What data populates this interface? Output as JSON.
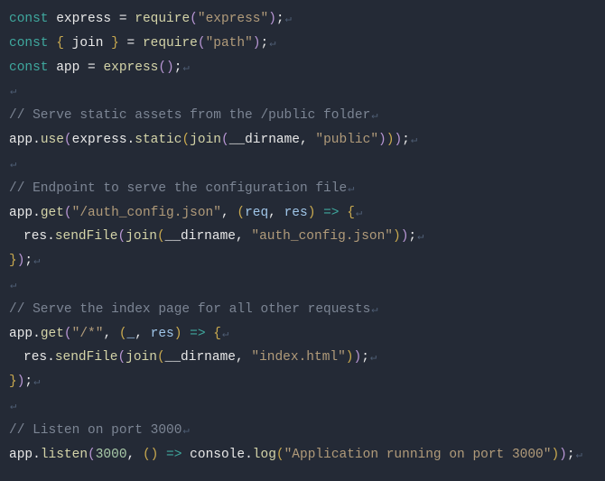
{
  "code": {
    "lines": [
      {
        "tokens": [
          {
            "t": "const ",
            "c": "tok-keyword"
          },
          {
            "t": "express ",
            "c": "tok-default"
          },
          {
            "t": "= ",
            "c": "tok-default"
          },
          {
            "t": "require",
            "c": "tok-method"
          },
          {
            "t": "(",
            "c": "tok-paren"
          },
          {
            "t": "\"express\"",
            "c": "tok-string"
          },
          {
            "t": ")",
            "c": "tok-paren"
          },
          {
            "t": ";",
            "c": "tok-default"
          }
        ],
        "eol": true,
        "indent": 0
      },
      {
        "tokens": [
          {
            "t": "const ",
            "c": "tok-keyword"
          },
          {
            "t": "{ ",
            "c": "tok-brace"
          },
          {
            "t": "join ",
            "c": "tok-default"
          },
          {
            "t": "} ",
            "c": "tok-brace"
          },
          {
            "t": "= ",
            "c": "tok-default"
          },
          {
            "t": "require",
            "c": "tok-method"
          },
          {
            "t": "(",
            "c": "tok-paren"
          },
          {
            "t": "\"path\"",
            "c": "tok-string"
          },
          {
            "t": ")",
            "c": "tok-paren"
          },
          {
            "t": ";",
            "c": "tok-default"
          }
        ],
        "eol": true,
        "indent": 0
      },
      {
        "tokens": [
          {
            "t": "const ",
            "c": "tok-keyword"
          },
          {
            "t": "app ",
            "c": "tok-default"
          },
          {
            "t": "= ",
            "c": "tok-default"
          },
          {
            "t": "express",
            "c": "tok-method"
          },
          {
            "t": "()",
            "c": "tok-paren"
          },
          {
            "t": ";",
            "c": "tok-default"
          }
        ],
        "eol": true,
        "indent": 0
      },
      {
        "tokens": [],
        "eol": true,
        "indent": 0
      },
      {
        "tokens": [
          {
            "t": "// Serve static assets from the /public folder",
            "c": "tok-comment"
          }
        ],
        "eol": true,
        "indent": 0
      },
      {
        "tokens": [
          {
            "t": "app.",
            "c": "tok-default"
          },
          {
            "t": "use",
            "c": "tok-method"
          },
          {
            "t": "(",
            "c": "tok-paren"
          },
          {
            "t": "express.",
            "c": "tok-default"
          },
          {
            "t": "static",
            "c": "tok-method"
          },
          {
            "t": "(",
            "c": "tok-brace"
          },
          {
            "t": "join",
            "c": "tok-method"
          },
          {
            "t": "(",
            "c": "tok-paren"
          },
          {
            "t": "__dirname, ",
            "c": "tok-default"
          },
          {
            "t": "\"public\"",
            "c": "tok-string"
          },
          {
            "t": ")",
            "c": "tok-paren"
          },
          {
            "t": ")",
            "c": "tok-brace"
          },
          {
            "t": ")",
            "c": "tok-paren"
          },
          {
            "t": ";",
            "c": "tok-default"
          }
        ],
        "eol": true,
        "indent": 0
      },
      {
        "tokens": [],
        "eol": true,
        "indent": 0
      },
      {
        "tokens": [
          {
            "t": "// Endpoint to serve the configuration file",
            "c": "tok-comment"
          }
        ],
        "eol": true,
        "indent": 0
      },
      {
        "tokens": [
          {
            "t": "app.",
            "c": "tok-default"
          },
          {
            "t": "get",
            "c": "tok-method"
          },
          {
            "t": "(",
            "c": "tok-paren"
          },
          {
            "t": "\"/auth_config.json\"",
            "c": "tok-string"
          },
          {
            "t": ", ",
            "c": "tok-default"
          },
          {
            "t": "(",
            "c": "tok-brace"
          },
          {
            "t": "req",
            "c": "tok-ident"
          },
          {
            "t": ", ",
            "c": "tok-default"
          },
          {
            "t": "res",
            "c": "tok-ident"
          },
          {
            "t": ")",
            "c": "tok-brace"
          },
          {
            "t": " => ",
            "c": "tok-keyword"
          },
          {
            "t": "{",
            "c": "tok-brace"
          }
        ],
        "eol": true,
        "indent": 0
      },
      {
        "tokens": [
          {
            "t": "res.",
            "c": "tok-default"
          },
          {
            "t": "sendFile",
            "c": "tok-method"
          },
          {
            "t": "(",
            "c": "tok-paren"
          },
          {
            "t": "join",
            "c": "tok-method"
          },
          {
            "t": "(",
            "c": "tok-brace"
          },
          {
            "t": "__dirname, ",
            "c": "tok-default"
          },
          {
            "t": "\"auth_config.json\"",
            "c": "tok-string"
          },
          {
            "t": ")",
            "c": "tok-brace"
          },
          {
            "t": ")",
            "c": "tok-paren"
          },
          {
            "t": ";",
            "c": "tok-default"
          }
        ],
        "eol": true,
        "indent": 1
      },
      {
        "tokens": [
          {
            "t": "}",
            "c": "tok-brace"
          },
          {
            "t": ")",
            "c": "tok-paren"
          },
          {
            "t": ";",
            "c": "tok-default"
          }
        ],
        "eol": true,
        "indent": 0
      },
      {
        "tokens": [],
        "eol": true,
        "indent": 0
      },
      {
        "tokens": [
          {
            "t": "// Serve the index page for all other requests",
            "c": "tok-comment"
          }
        ],
        "eol": true,
        "indent": 0
      },
      {
        "tokens": [
          {
            "t": "app.",
            "c": "tok-default"
          },
          {
            "t": "get",
            "c": "tok-method"
          },
          {
            "t": "(",
            "c": "tok-paren"
          },
          {
            "t": "\"/*\"",
            "c": "tok-string"
          },
          {
            "t": ", ",
            "c": "tok-default"
          },
          {
            "t": "(",
            "c": "tok-brace"
          },
          {
            "t": "_",
            "c": "tok-ident"
          },
          {
            "t": ", ",
            "c": "tok-default"
          },
          {
            "t": "res",
            "c": "tok-ident"
          },
          {
            "t": ")",
            "c": "tok-brace"
          },
          {
            "t": " => ",
            "c": "tok-keyword"
          },
          {
            "t": "{",
            "c": "tok-brace"
          }
        ],
        "eol": true,
        "indent": 0
      },
      {
        "tokens": [
          {
            "t": "res.",
            "c": "tok-default"
          },
          {
            "t": "sendFile",
            "c": "tok-method"
          },
          {
            "t": "(",
            "c": "tok-paren"
          },
          {
            "t": "join",
            "c": "tok-method"
          },
          {
            "t": "(",
            "c": "tok-brace"
          },
          {
            "t": "__dirname, ",
            "c": "tok-default"
          },
          {
            "t": "\"index.html\"",
            "c": "tok-string"
          },
          {
            "t": ")",
            "c": "tok-brace"
          },
          {
            "t": ")",
            "c": "tok-paren"
          },
          {
            "t": ";",
            "c": "tok-default"
          }
        ],
        "eol": true,
        "indent": 1
      },
      {
        "tokens": [
          {
            "t": "}",
            "c": "tok-brace"
          },
          {
            "t": ")",
            "c": "tok-paren"
          },
          {
            "t": ";",
            "c": "tok-default"
          }
        ],
        "eol": true,
        "indent": 0
      },
      {
        "tokens": [],
        "eol": true,
        "indent": 0
      },
      {
        "tokens": [
          {
            "t": "// Listen on port 3000",
            "c": "tok-comment"
          }
        ],
        "eol": true,
        "indent": 0
      },
      {
        "tokens": [
          {
            "t": "app.",
            "c": "tok-default"
          },
          {
            "t": "listen",
            "c": "tok-method"
          },
          {
            "t": "(",
            "c": "tok-paren"
          },
          {
            "t": "3000",
            "c": "tok-number"
          },
          {
            "t": ", ",
            "c": "tok-default"
          },
          {
            "t": "()",
            "c": "tok-brace"
          },
          {
            "t": " => ",
            "c": "tok-keyword"
          },
          {
            "t": "console.",
            "c": "tok-default"
          },
          {
            "t": "log",
            "c": "tok-method"
          },
          {
            "t": "(",
            "c": "tok-brace"
          },
          {
            "t": "\"Application running on port 3000\"",
            "c": "tok-string"
          },
          {
            "t": ")",
            "c": "tok-brace"
          },
          {
            "t": ")",
            "c": "tok-paren"
          },
          {
            "t": ";",
            "c": "tok-default"
          }
        ],
        "eol": true,
        "indent": 0
      }
    ],
    "eol_marker": "↵"
  }
}
